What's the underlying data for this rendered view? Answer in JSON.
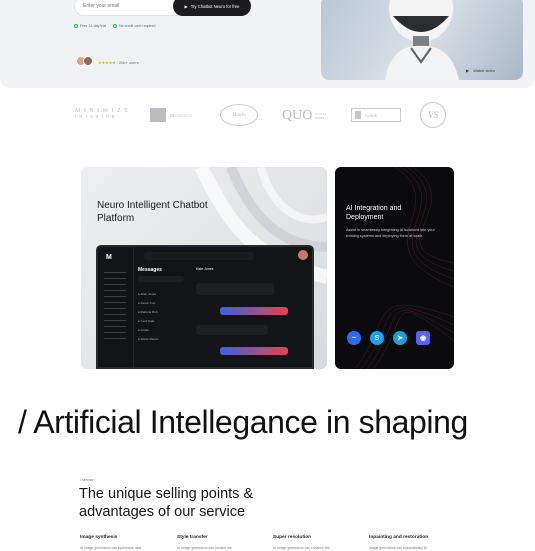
{
  "hero": {
    "email_placeholder": "Enter your email",
    "cta_label": "Try Chatbot Neuro for free",
    "features": [
      "Free 14-day trial",
      "No credit card required"
    ],
    "rating_stars": "★★★★★",
    "rating_users": "20k+ users",
    "watch_video": "Watch video"
  },
  "logos": [
    "M I N I M I Z E",
    "I N T E R I O R",
    "HELVETICA",
    "Monks",
    "QUO",
    "LEGAL FIRM",
    "Kodiak",
    "VS"
  ],
  "cards": {
    "platform_title": "Neuro Intelligent Chatbot Platform",
    "integration_title": "AI Integration and Deployment",
    "integration_desc": "Assist in seamlessly integrating AI solutions into your existing systems and deploying them at scale.",
    "integration_icons": [
      "messenger-icon",
      "skype-icon",
      "telegram-icon",
      "discord-icon"
    ]
  },
  "app": {
    "messages_title": "Messages",
    "contacts": [
      "Allan Jones",
      "Devon Fox",
      "Darlene Rob",
      "Cecil Hale",
      "Kristin",
      "Wade Warren"
    ],
    "chat_name": "Kate Jones"
  },
  "headline": "/ Artificial Intellegance in shaping",
  "services": {
    "tag": "/ service /",
    "title": "The unique selling points & advantages of our service",
    "items": [
      {
        "title": "Image synthesis",
        "desc": "AI image generators can synthesize new"
      },
      {
        "title": "Style transfer",
        "desc": "AI image generators can transfer the"
      },
      {
        "title": "Super resolution",
        "desc": "AI image generators can enhance the"
      },
      {
        "title": "Inpainting and restoration",
        "desc": "Image generators can automatically fill"
      }
    ]
  },
  "colors": {
    "accent_red": "#e8444a",
    "accent_blue": "#3b62e0",
    "dark": "#131418"
  }
}
